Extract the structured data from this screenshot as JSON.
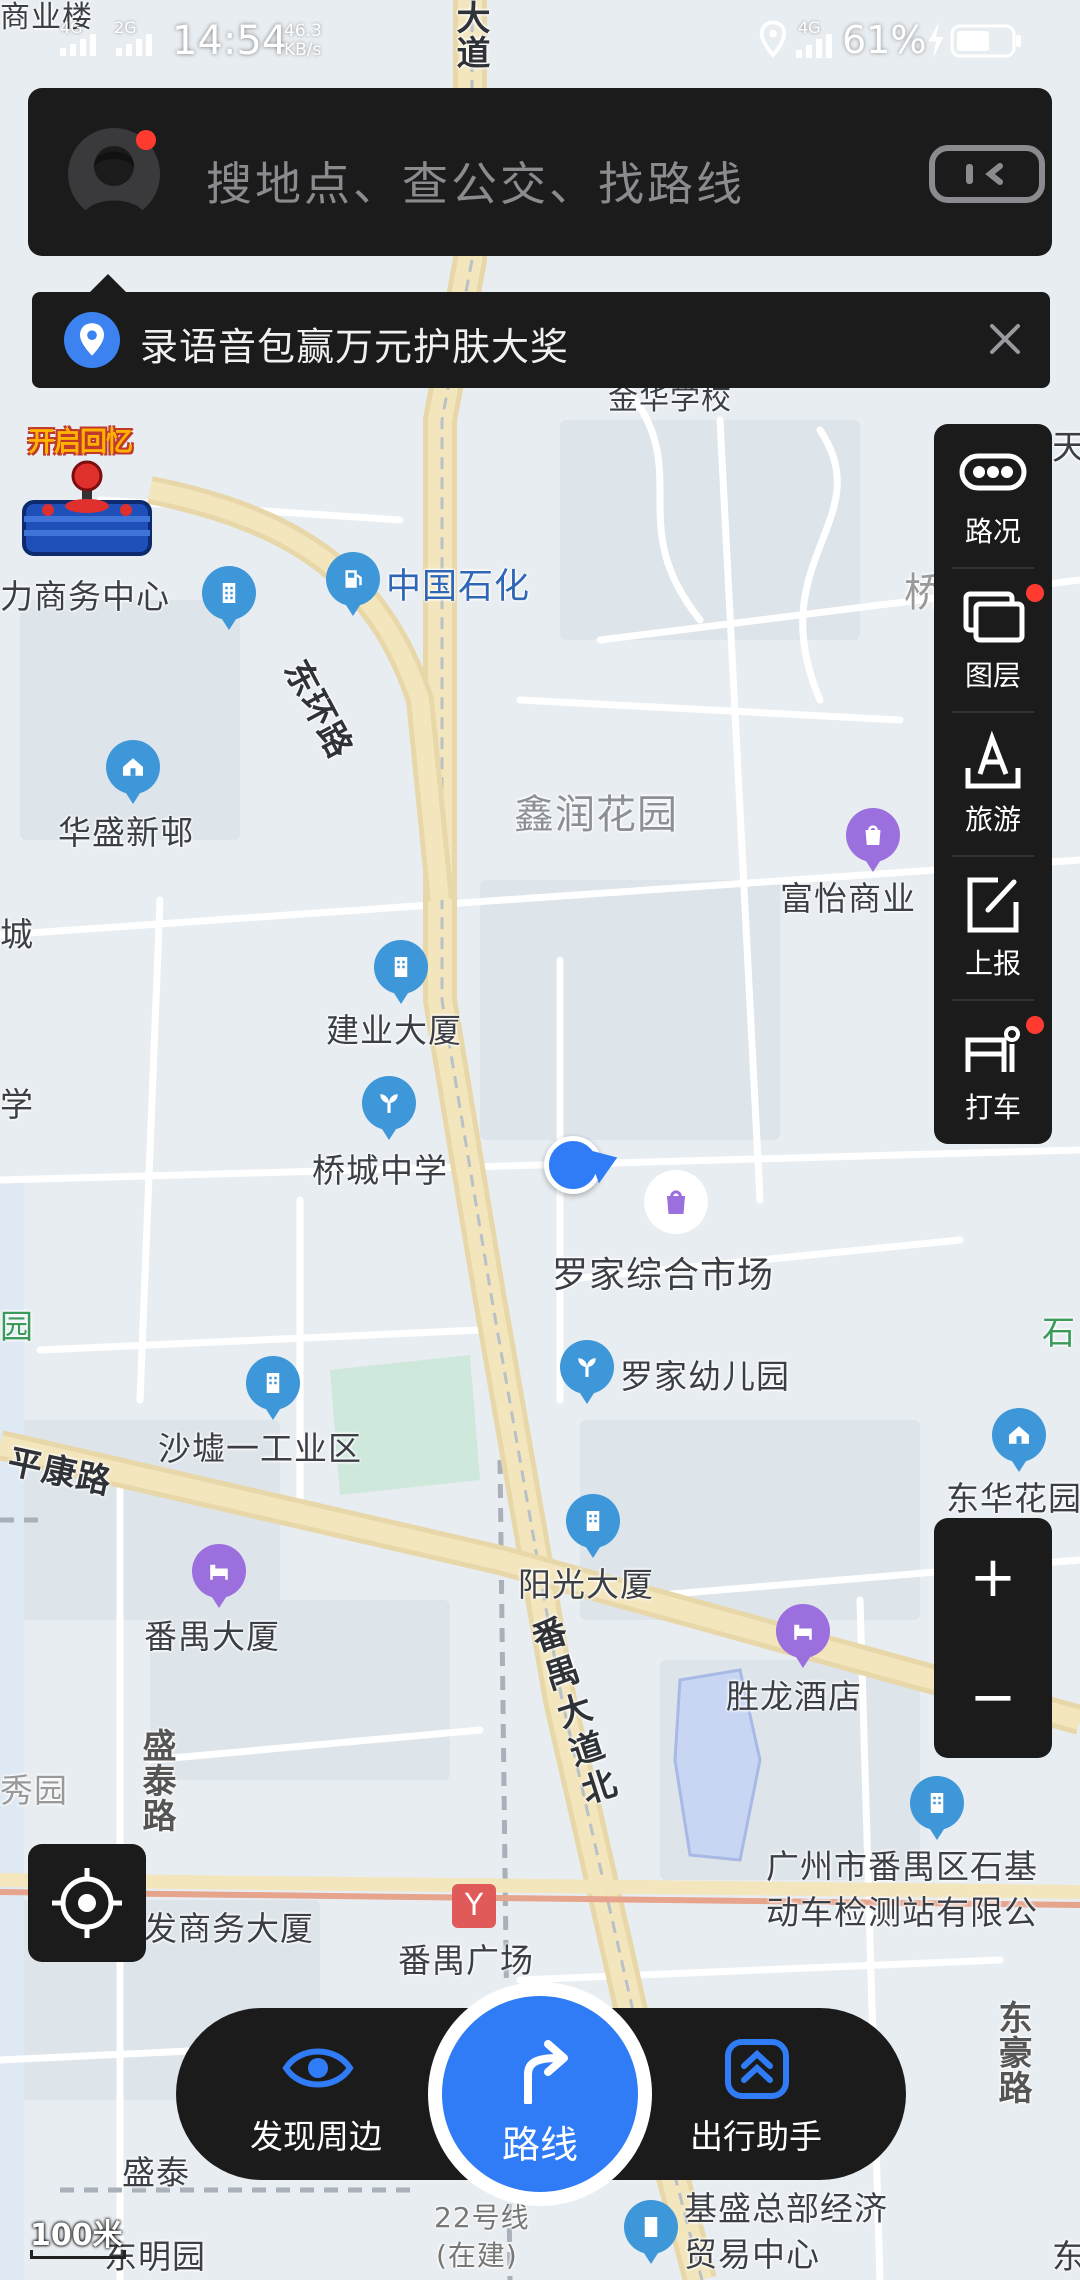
{
  "status_bar": {
    "time": "14:54",
    "net_speed": "46.3",
    "net_speed_unit": "KB/s",
    "signal_1": "4G",
    "signal_2": "2G",
    "signal_3": "4G",
    "battery": "61%"
  },
  "search": {
    "placeholder": "搜地点、查公交、找路线"
  },
  "banner": {
    "text": "录语音包赢万元护肤大奖"
  },
  "promo": {
    "label": "开启回忆"
  },
  "toolbar": {
    "items": [
      {
        "label": "路况"
      },
      {
        "label": "图层"
      },
      {
        "label": "旅游"
      },
      {
        "label": "上报"
      },
      {
        "label": "打车"
      }
    ]
  },
  "zoom": {
    "in": "+",
    "out": "−"
  },
  "bottom_nav": {
    "discover": "发现周边",
    "route": "路线",
    "assistant": "出行助手"
  },
  "scale": {
    "label": "100米"
  },
  "map": {
    "areas": {
      "xinrun": "鑫润花园"
    },
    "roads": {
      "donghuan": "东环路",
      "pingkang": "平康路",
      "panyu_dadao_bei": "番禺大道北",
      "shengtai": "盛泰路",
      "donghao": "东豪路",
      "dadao_top": "大道"
    },
    "pois": {
      "sinopec": "中国石化",
      "lishang": "力商务中心",
      "huasheng": "华盛新邨",
      "jianye": "建业大厦",
      "qiaocheng": "桥城中学",
      "fuyi": "富怡商业",
      "luojia_market": "罗家综合市场",
      "luojia_kindergarten": "罗家幼儿园",
      "shatang": "沙墟一工业区",
      "yangguang": "阳光大厦",
      "panyu_dasha": "番禺大厦",
      "shenglong": "胜龙酒店",
      "donghua": "东华花园",
      "checkstation_1": "广州市番禺区石基",
      "checkstation_2": "动车检测站有限公",
      "fashang": "发商务大厦",
      "panyu_square": "番禺广场",
      "jisheng_1": "基盛总部经济",
      "jisheng_2": "贸易中心",
      "line22": "22号线",
      "zaijian": "(在建)",
      "dongming": "东明园",
      "shengtai_short": "盛泰",
      "jinhua": "金华学校",
      "shangyelou": "商业楼",
      "cheng": "城",
      "xue": "学",
      "yuan": "园",
      "xiuyuan": "秀园",
      "shi": "石",
      "qiao": "桥",
      "tian": "天",
      "dong": "东"
    }
  }
}
